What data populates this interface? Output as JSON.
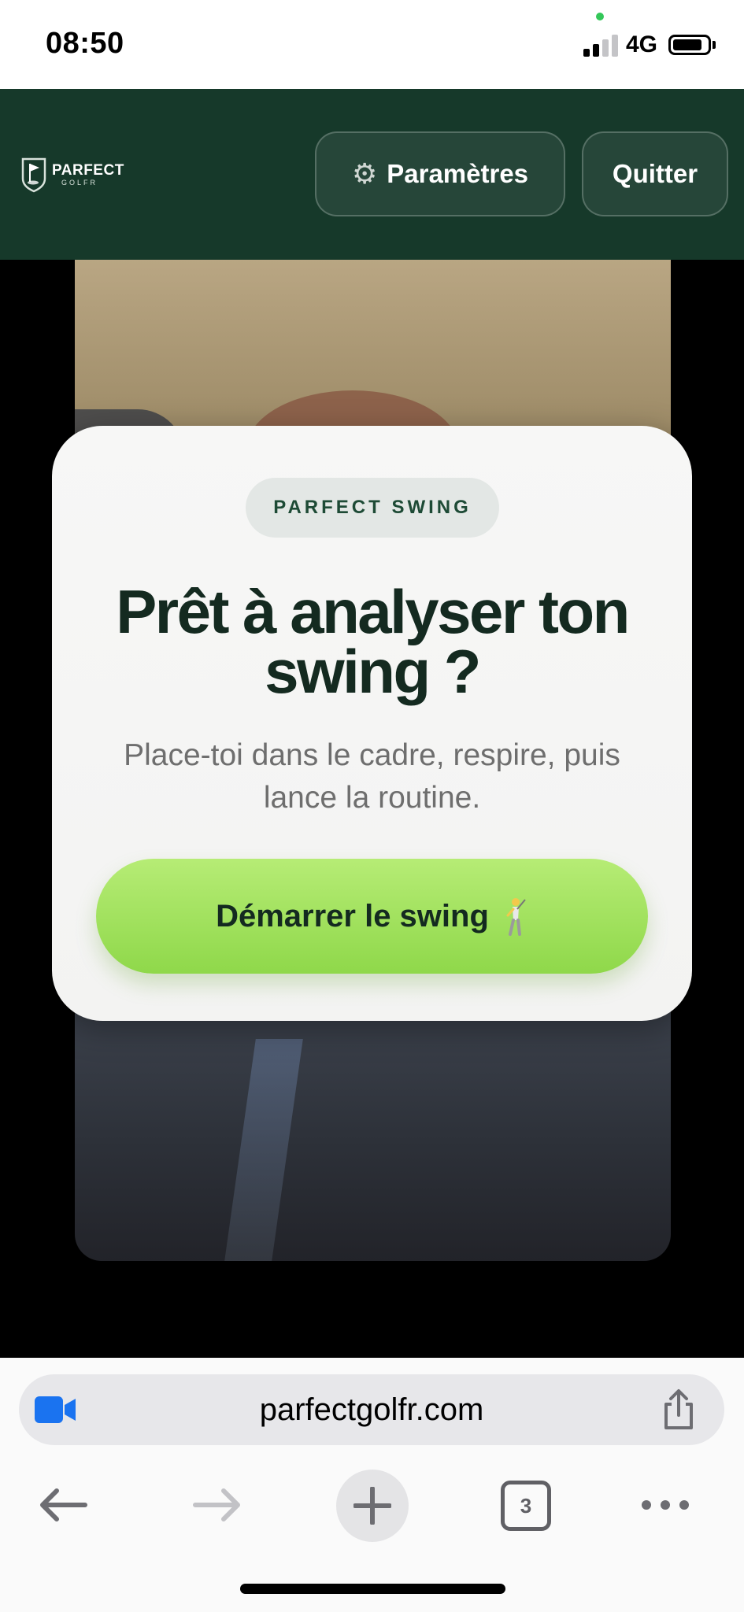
{
  "status_bar": {
    "time": "08:50",
    "network": "4G",
    "battery_level": 0.85,
    "signal_bars": 2,
    "signal_total": 4
  },
  "header": {
    "logo_main": "PARFECT",
    "logo_sub": "GOLFR",
    "settings_icon": "gear-icon",
    "settings_label": "Paramètres",
    "quit_label": "Quitter",
    "background_color": "#16392a"
  },
  "dialog": {
    "badge": "PARFECT SWING",
    "title": "Prêt à analyser ton swing ?",
    "subtitle": "Place-toi dans le cadre, respire, puis lance la routine.",
    "start_button_label": "Démarrer le swing",
    "start_button_icon": "golfer-icon",
    "accent_color": "#9fe05a"
  },
  "browser": {
    "url": "parfectgolfr.com",
    "tab_count": "3",
    "icons": [
      "video-camera-icon",
      "share-icon",
      "back-arrow-icon",
      "forward-arrow-icon",
      "plus-icon",
      "tabs-icon",
      "more-icon"
    ]
  }
}
